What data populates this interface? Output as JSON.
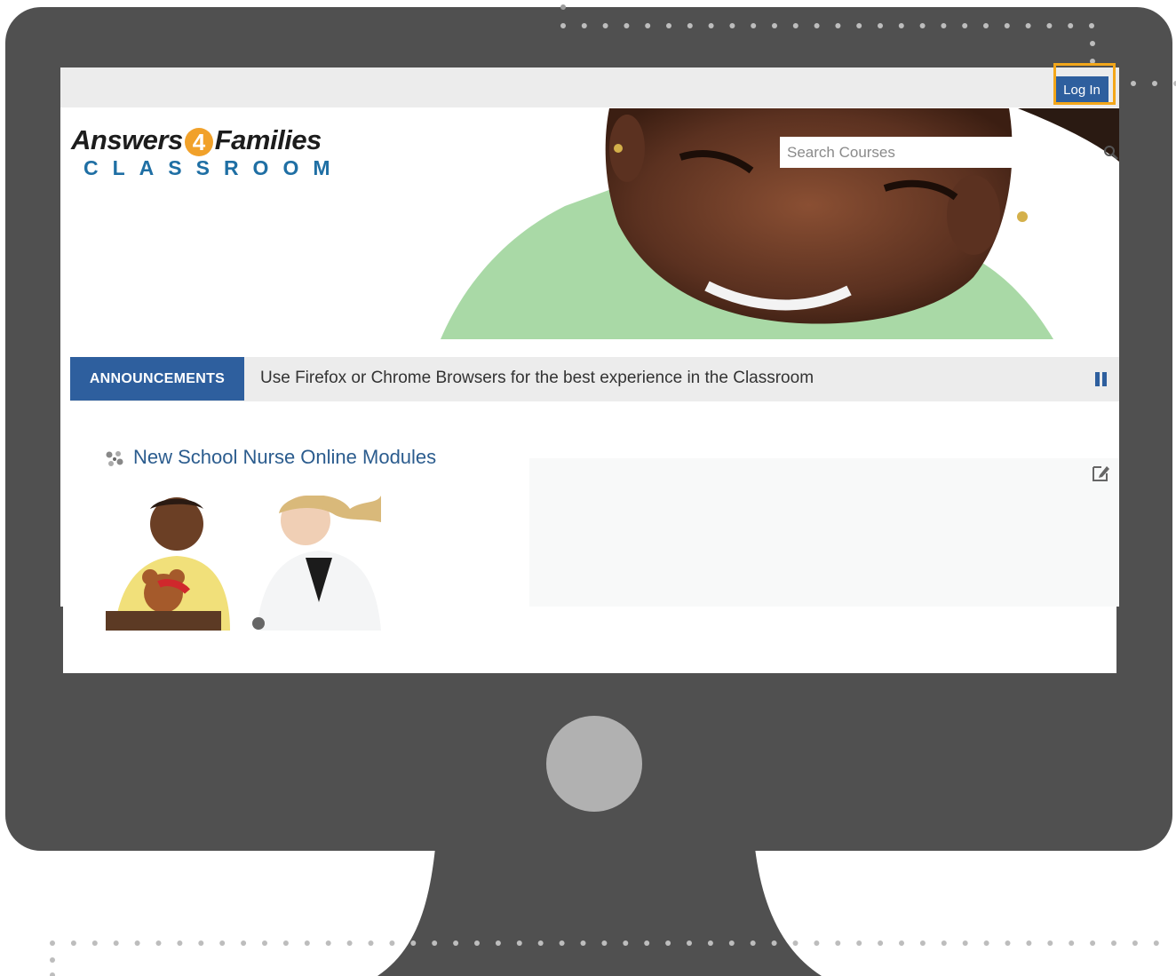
{
  "header": {
    "login_label": "Log In"
  },
  "logo": {
    "word_left": "Answers",
    "number": "4",
    "word_right": "Families",
    "subtitle": "CLASSROOM"
  },
  "search": {
    "placeholder": "Search Courses"
  },
  "announcements": {
    "label": "ANNOUNCEMENTS",
    "message": "Use Firefox or Chrome Browsers for the best experience in the Classroom"
  },
  "course": {
    "title": "New School Nurse Online Modules"
  },
  "icons": {
    "search": "search-icon",
    "pause": "pause-icon",
    "course": "course-icon",
    "edit": "edit-icon"
  },
  "colors": {
    "monitor": "#505050",
    "accent_blue": "#2e5f9e",
    "highlight": "#f3a71a",
    "logo_orange": "#f1a12a",
    "logo_blue": "#1f6fa4",
    "link": "#2b5c8e"
  }
}
